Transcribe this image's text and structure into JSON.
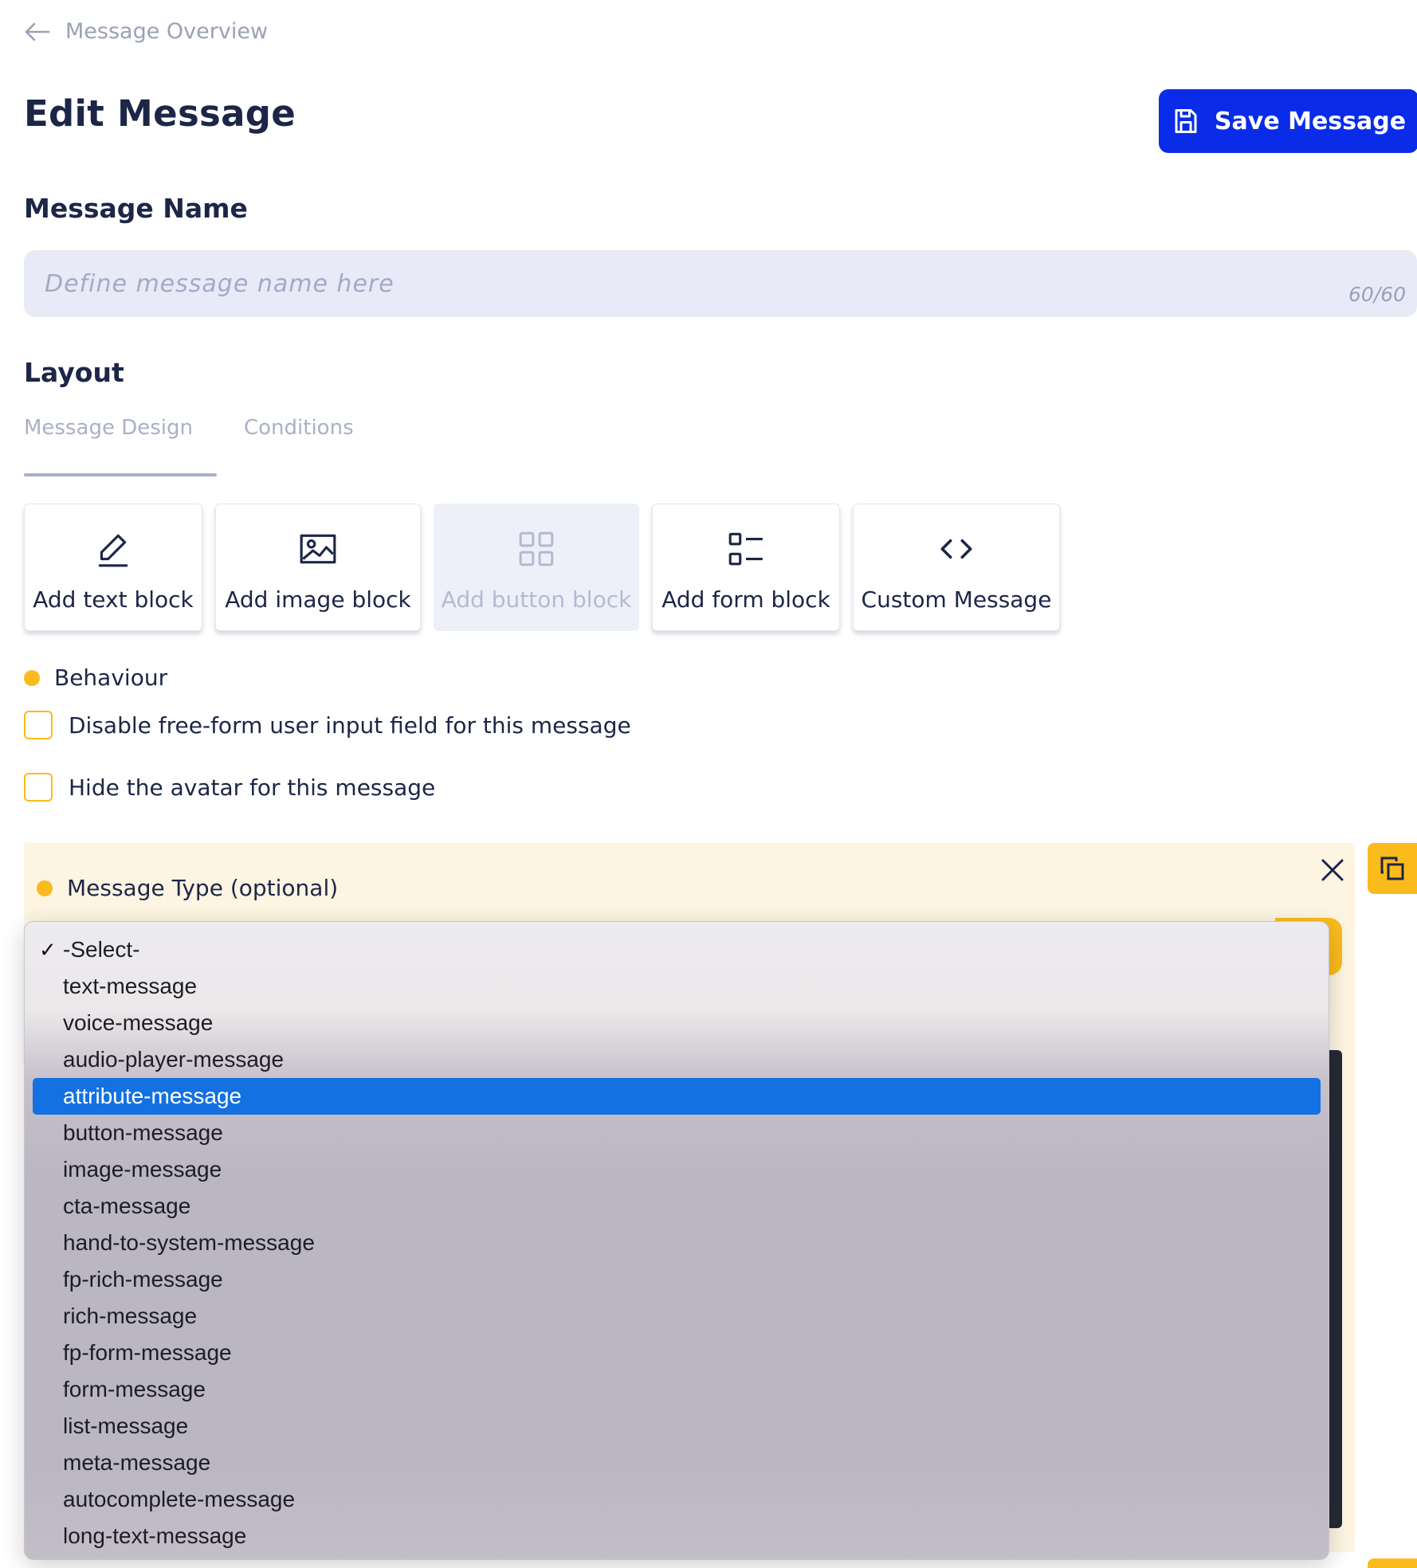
{
  "breadcrumb": {
    "back_label": "Message Overview"
  },
  "page": {
    "title": "Edit Message"
  },
  "toolbar": {
    "save_label": "Save Message"
  },
  "message_name": {
    "heading": "Message Name",
    "placeholder": "Define message name here",
    "value": "",
    "char_count": "60/60"
  },
  "layout": {
    "heading": "Layout",
    "tabs": [
      {
        "label": "Message Design",
        "active": true
      },
      {
        "label": "Conditions",
        "active": false
      }
    ],
    "blocks": [
      {
        "label": "Add text block",
        "icon": "pencil-icon",
        "disabled": false
      },
      {
        "label": "Add image block",
        "icon": "image-icon",
        "disabled": false
      },
      {
        "label": "Add button block",
        "icon": "grid-icon",
        "disabled": true
      },
      {
        "label": "Add form block",
        "icon": "form-list-icon",
        "disabled": false
      },
      {
        "label": "Custom Message",
        "icon": "code-icon",
        "disabled": false
      }
    ]
  },
  "behaviour": {
    "label": "Behaviour",
    "options": [
      {
        "label": "Disable free-form user input field for this message",
        "checked": false
      },
      {
        "label": "Hide the avatar for this message",
        "checked": false
      }
    ]
  },
  "message_type": {
    "label": "Message Type (optional)",
    "selected": "-Select-",
    "highlighted": "attribute-message",
    "options": [
      "-Select-",
      "text-message",
      "voice-message",
      "audio-player-message",
      "attribute-message",
      "button-message",
      "image-message",
      "cta-message",
      "hand-to-system-message",
      "fp-rich-message",
      "rich-message",
      "fp-form-message",
      "form-message",
      "list-message",
      "meta-message",
      "autocomplete-message",
      "long-text-message"
    ]
  },
  "colors": {
    "primary": "#0a2ce8",
    "accent": "#fbbb1d",
    "heading": "#1c2647",
    "highlight": "#1471e2",
    "panel_bg": "#fdf4e2"
  }
}
